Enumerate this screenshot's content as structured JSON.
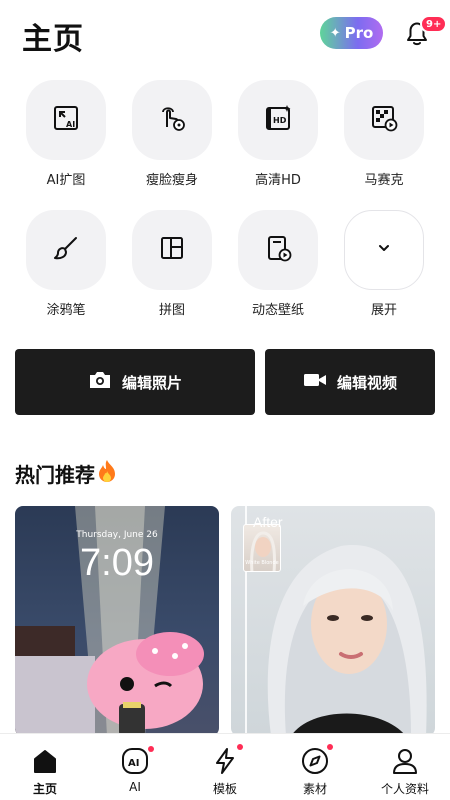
{
  "header": {
    "title": "主页",
    "pro_label": "Pro",
    "notification_badge": "9+"
  },
  "tools": [
    {
      "label": "AI扩图",
      "icon": "ai-expand-icon"
    },
    {
      "label": "瘦脸瘦身",
      "icon": "slim-touch-icon"
    },
    {
      "label": "高清HD",
      "icon": "hd-enhance-icon"
    },
    {
      "label": "马赛克",
      "icon": "mosaic-icon"
    },
    {
      "label": "涂鸦笔",
      "icon": "brush-icon"
    },
    {
      "label": "拼图",
      "icon": "collage-icon"
    },
    {
      "label": "动态壁纸",
      "icon": "live-wallpaper-icon"
    },
    {
      "label": "展开",
      "icon": "chevron-down-icon"
    }
  ],
  "actions": {
    "edit_photo": "编辑照片",
    "edit_video": "编辑视频"
  },
  "section": {
    "title": "热门推荐",
    "title_icon": "fire-emoji"
  },
  "cards": {
    "lockscreen_date": "Thursday, June 26",
    "lockscreen_time": "7:09",
    "after_label": "After",
    "thumb_caption": "White Blonde"
  },
  "nav": [
    {
      "label": "主页",
      "icon": "home-icon",
      "active": true,
      "dot": false
    },
    {
      "label": "AI",
      "icon": "ai-icon",
      "active": false,
      "dot": true
    },
    {
      "label": "模板",
      "icon": "lightning-icon",
      "active": false,
      "dot": true
    },
    {
      "label": "素材",
      "icon": "compass-icon",
      "active": false,
      "dot": true
    },
    {
      "label": "个人资料",
      "icon": "profile-icon",
      "active": false,
      "dot": false
    }
  ],
  "colors": {
    "badge": "#ff2d55",
    "action_bg": "#1c1c1c",
    "tile_bg": "#f2f2f4"
  }
}
